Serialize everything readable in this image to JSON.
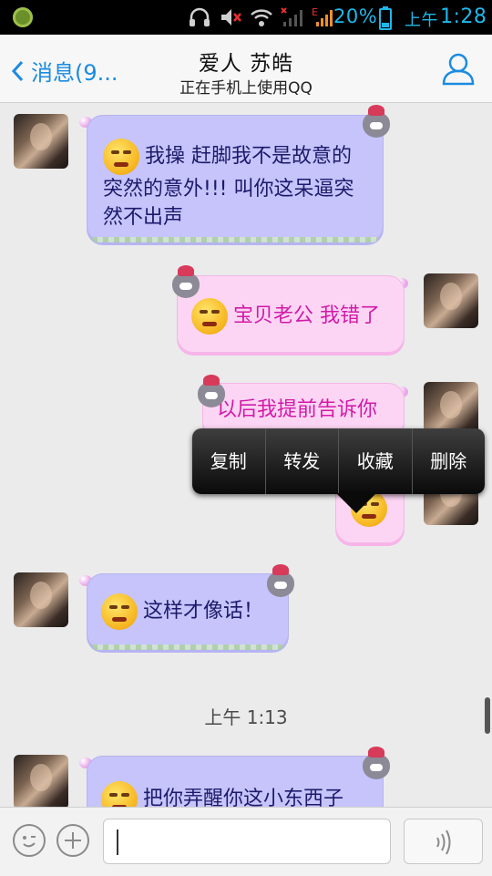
{
  "status_bar": {
    "battery_percent": "20%",
    "time_period": "上午",
    "time": "1:28"
  },
  "header": {
    "back_label": "消息(9...",
    "title": "爱人  苏皓",
    "subtitle": "正在手机上使用QQ"
  },
  "messages": [
    {
      "side": "in",
      "text": "我操 赶脚我不是故意的突然的意外!!! 叫你这呆逼突然不出声"
    },
    {
      "side": "out",
      "text": "宝贝老公 我错了"
    },
    {
      "side": "out",
      "text": "以后我提前告诉你"
    },
    {
      "side": "in",
      "text": "这样才像话！"
    },
    {
      "side": "in",
      "text": "把你弄醒你这小东西子"
    }
  ],
  "time_separator": "上午 1:13",
  "context_menu": {
    "items": [
      "复制",
      "转发",
      "收藏",
      "删除"
    ]
  },
  "input": {
    "value": ""
  },
  "colors": {
    "incoming_bubble": "#c6c4fb",
    "outgoing_bubble": "#fdd5f4",
    "outgoing_text": "#d21aa8",
    "incoming_text": "#1e1a6b",
    "accent": "#1a8be0"
  }
}
